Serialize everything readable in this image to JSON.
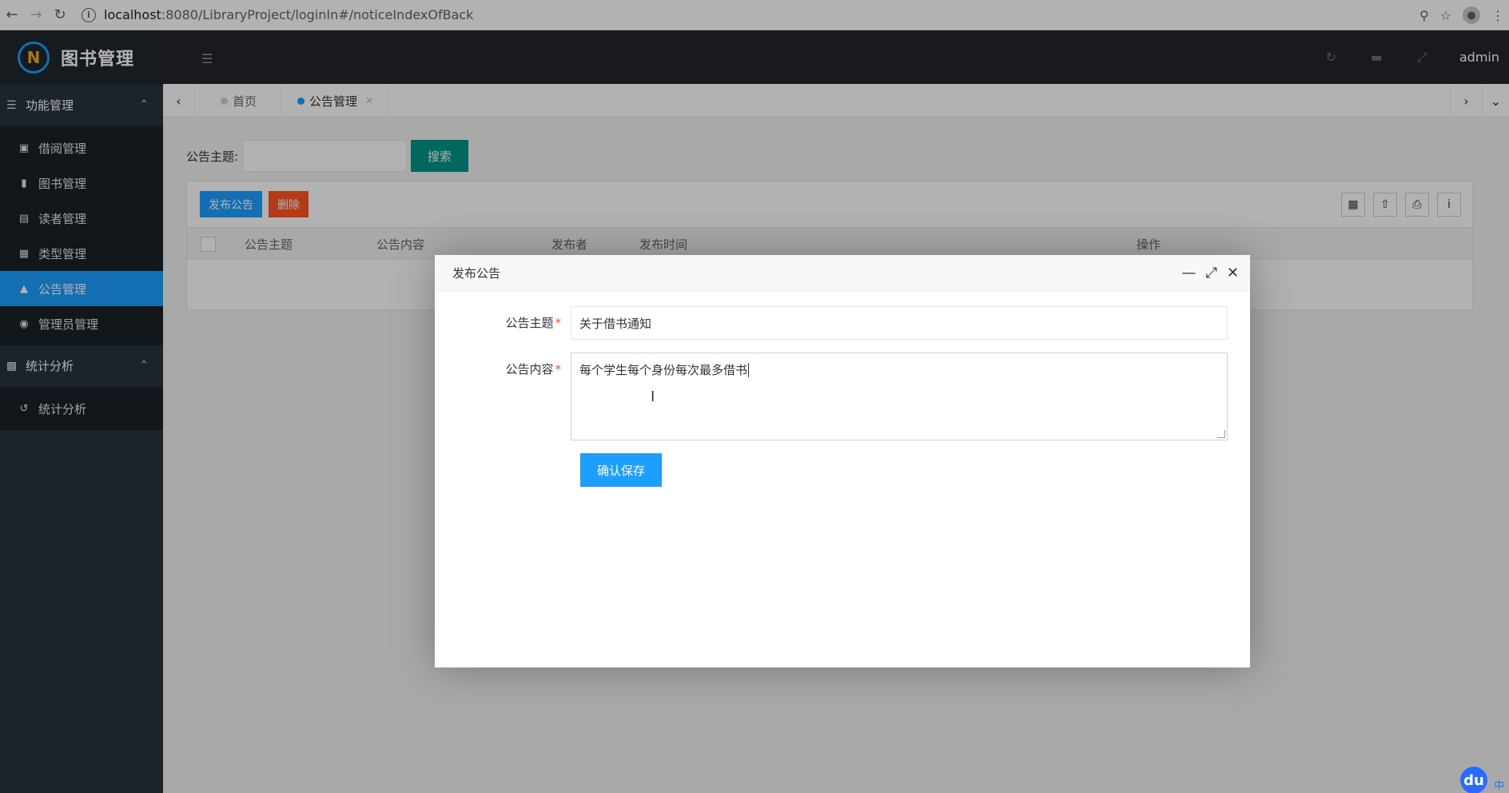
{
  "browser": {
    "url_host": "localhost",
    "url_path": ":8080/LibraryProject/loginIn#/noticeIndexOfBack",
    "info_icon": "i"
  },
  "sidebar": {
    "logo_text": "图书管理",
    "logo_mark": "N",
    "groups": [
      {
        "label": "功能管理",
        "items": [
          {
            "label": "借阅管理",
            "icon": "card-icon"
          },
          {
            "label": "图书管理",
            "icon": "book-icon"
          },
          {
            "label": "读者管理",
            "icon": "id-card-icon"
          },
          {
            "label": "类型管理",
            "icon": "file-icon"
          },
          {
            "label": "公告管理",
            "icon": "bell-icon"
          },
          {
            "label": "管理员管理",
            "icon": "user-circle-icon"
          }
        ]
      },
      {
        "label": "统计分析",
        "items": [
          {
            "label": "统计分析",
            "icon": "refresh-icon"
          }
        ]
      }
    ]
  },
  "header": {
    "user": "admin"
  },
  "tabs": [
    {
      "label": "首页",
      "active": false
    },
    {
      "label": "公告管理",
      "active": true
    }
  ],
  "search": {
    "label": "公告主题:",
    "button": "搜索"
  },
  "table": {
    "toolbar": {
      "publish": "发布公告",
      "delete": "删除"
    },
    "headers": [
      "公告主题",
      "公告内容",
      "发布者",
      "发布时间",
      "操作"
    ]
  },
  "modal": {
    "title": "发布公告",
    "fields": {
      "subject_label": "公告主题",
      "subject_value": "关于借书通知",
      "content_label": "公告内容",
      "content_value": "每个学生每个身份每次最多借书"
    },
    "save_button": "确认保存"
  },
  "ime": {
    "du": "du",
    "lang": "中"
  },
  "colors": {
    "sidebar_bg": "#28333e",
    "active_menu": "#1e9fff",
    "header_bg": "#23262e",
    "search_btn": "#009688",
    "delete_btn": "#ff5722"
  }
}
